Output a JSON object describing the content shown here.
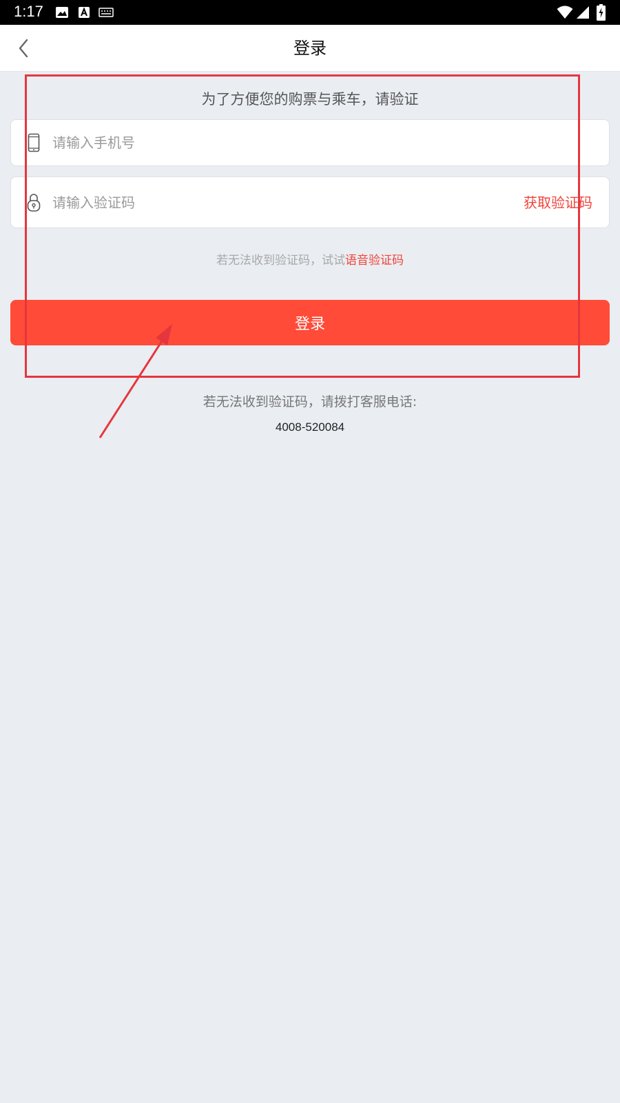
{
  "status_bar": {
    "time": "1:17",
    "icons": [
      "image-icon",
      "font-a-icon",
      "keyboard-icon",
      "wifi-icon",
      "signal-icon",
      "battery-charging-icon"
    ]
  },
  "header": {
    "title": "登录",
    "back_icon": "chevron-left-icon"
  },
  "form": {
    "hint": "为了方便您的购票与乘车，请验证",
    "phone_placeholder": "请输入手机号",
    "phone_icon": "phone-icon",
    "code_placeholder": "请输入验证码",
    "code_icon": "lock-icon",
    "get_code_label": "获取验证码",
    "voice_prefix": "若无法收到验证码，试试",
    "voice_link": "语音验证码",
    "login_label": "登录"
  },
  "support": {
    "text": "若无法收到验证码，请拨打客服电话:",
    "phone": "4008-520084"
  },
  "colors": {
    "accent": "#ff4b38",
    "link": "#f0443a",
    "background": "#eaedf2",
    "annotation": "#e5363d"
  }
}
